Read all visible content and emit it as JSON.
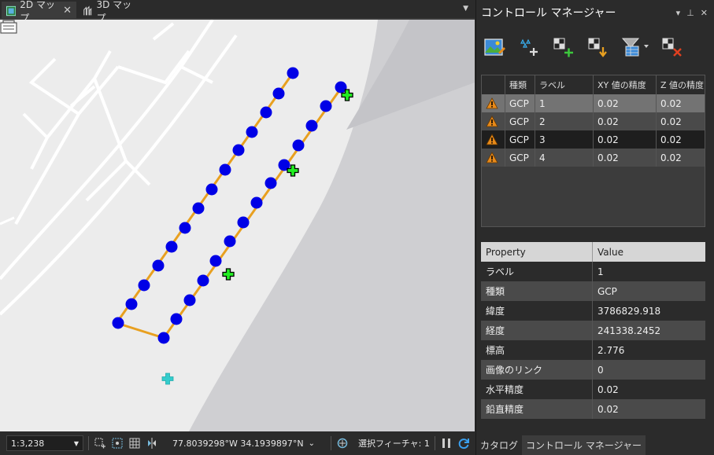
{
  "tabs": [
    {
      "label": "2D マップ",
      "icon": "map-2d-icon",
      "active": true
    },
    {
      "label": "3D マップ",
      "icon": "map-3d-icon",
      "active": false
    }
  ],
  "status": {
    "scale": "1:3,238",
    "coordinates": "77.8039298°W 34.1939897°N",
    "selected_features": "選択フィーチャ: 1"
  },
  "panel": {
    "title": "コントロール マネージャー",
    "table": {
      "columns": [
        "",
        "種類",
        "ラベル",
        "XY 値の精度",
        "Z 値の精度"
      ],
      "rows": [
        {
          "type": "GCP",
          "label": "1",
          "xy": "0.02",
          "z": "0.02"
        },
        {
          "type": "GCP",
          "label": "2",
          "xy": "0.02",
          "z": "0.02"
        },
        {
          "type": "GCP",
          "label": "3",
          "xy": "0.02",
          "z": "0.02"
        },
        {
          "type": "GCP",
          "label": "4",
          "xy": "0.02",
          "z": "0.02"
        }
      ]
    },
    "properties": {
      "header": {
        "key": "Property",
        "value": "Value"
      },
      "rows": [
        {
          "key": "ラベル",
          "value": "1"
        },
        {
          "key": "種類",
          "value": "GCP"
        },
        {
          "key": "緯度",
          "value": "3786829.918"
        },
        {
          "key": "経度",
          "value": "241338.2452"
        },
        {
          "key": "標高",
          "value": "2.776"
        },
        {
          "key": "画像のリンク",
          "value": "0"
        },
        {
          "key": "水平精度",
          "value": "0.02"
        },
        {
          "key": "鉛直精度",
          "value": "0.02"
        }
      ]
    },
    "bottom_tabs": [
      "カタログ",
      "コントロール マネージャー"
    ]
  },
  "colors": {
    "flight_line": "#e8a020",
    "waypoint": "#0000e6",
    "gcp_green": "#22ee22",
    "gcp_cyan": "#33cccc",
    "warning": "#e88a1a"
  }
}
